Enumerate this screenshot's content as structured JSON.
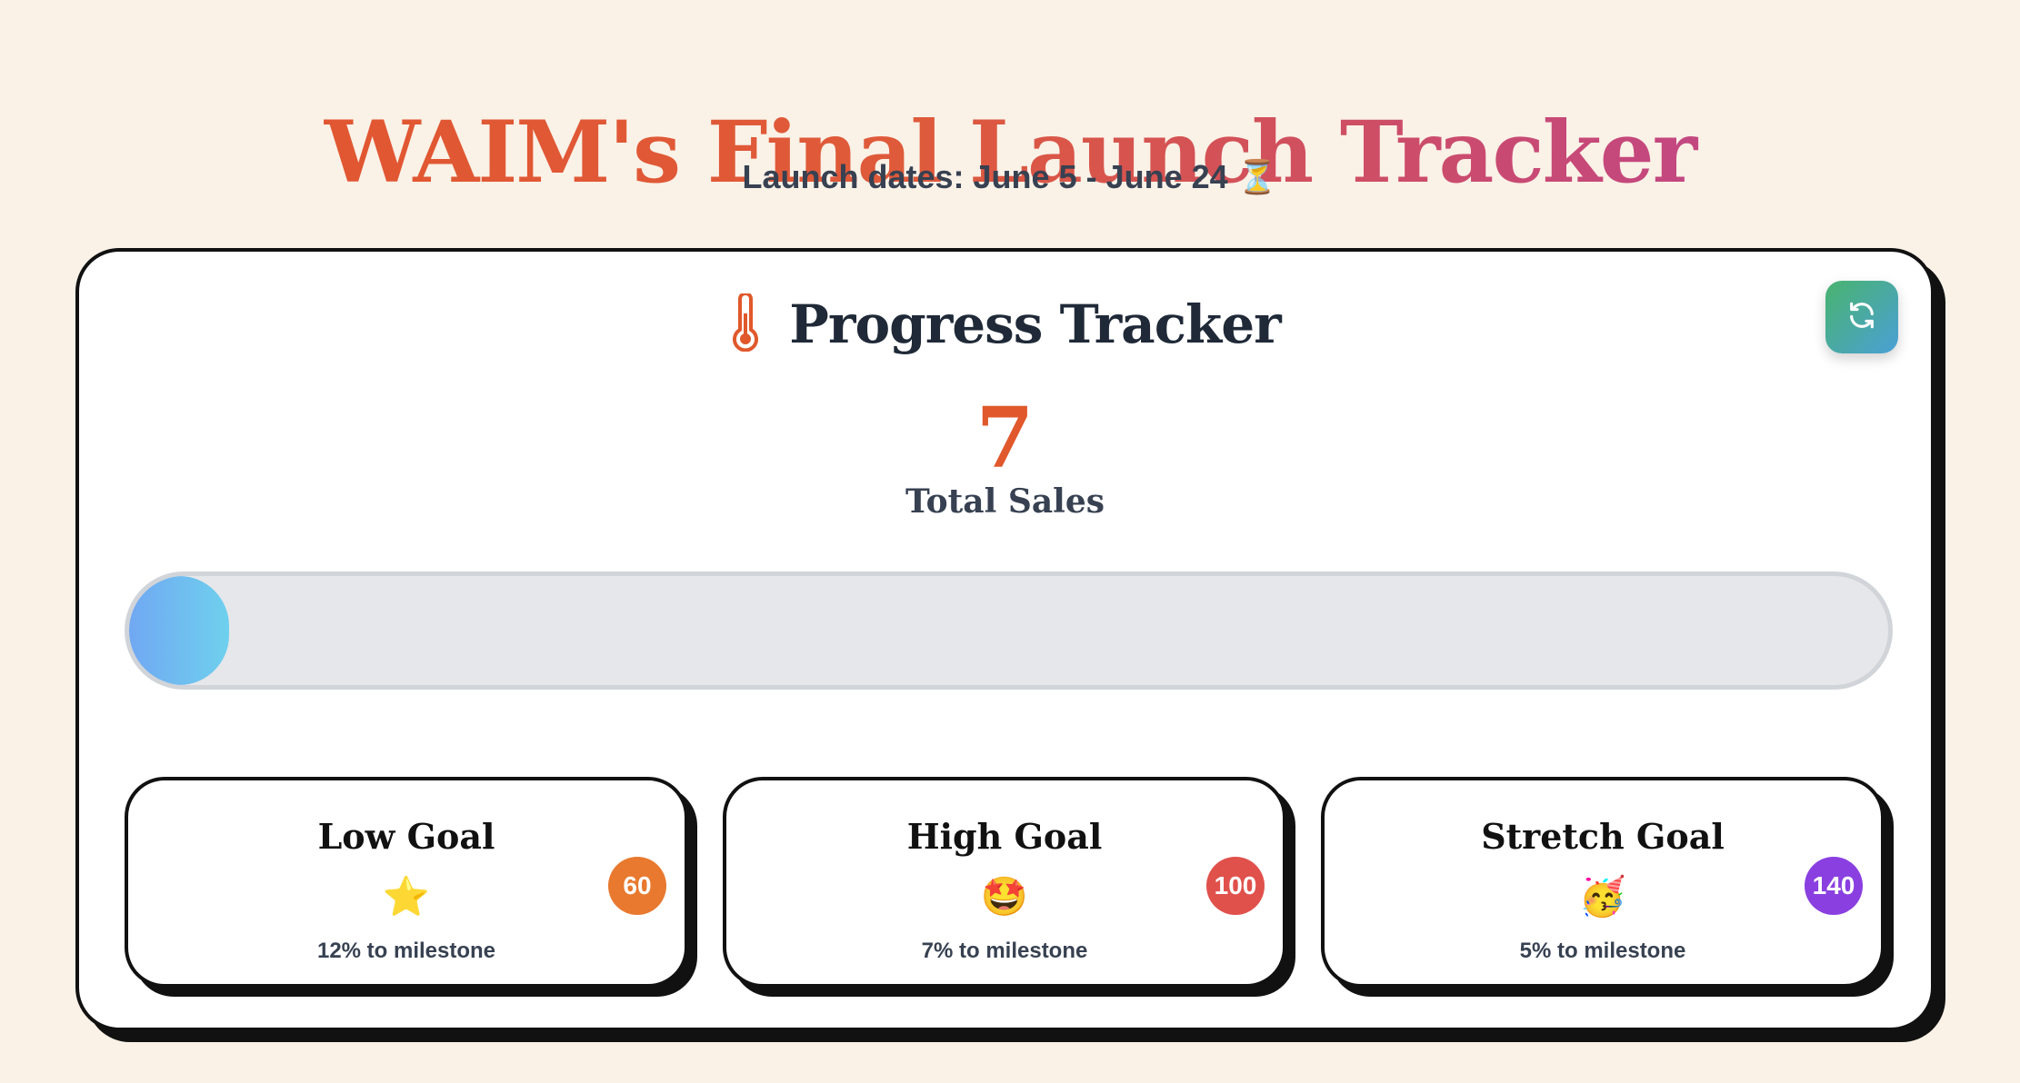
{
  "header": {
    "title": "WAIM's Final Launch Tracker",
    "subtitle": "Launch dates: June 5 - June 24 ⏳"
  },
  "tracker": {
    "heading": "Progress Tracker",
    "heading_icon": "thermometer-icon",
    "refresh_icon": "refresh-icon",
    "total_sales": "7",
    "total_sales_label": "Total Sales",
    "progress_fraction": 0.05
  },
  "goals": [
    {
      "title": "Low Goal",
      "emoji": "⭐",
      "emoji_name": "star",
      "target": "60",
      "progress_text": "12% to milestone",
      "color": "#e8792f"
    },
    {
      "title": "High Goal",
      "emoji": "🤩",
      "emoji_name": "star-struck",
      "target": "100",
      "progress_text": "7% to milestone",
      "color": "#e0514c"
    },
    {
      "title": "Stretch Goal",
      "emoji": "🥳",
      "emoji_name": "partying-face",
      "target": "140",
      "progress_text": "5% to milestone",
      "color": "#8a3fe0"
    }
  ],
  "colors": {
    "background": "#faf1e7",
    "accent": "#e0582b",
    "progress_start": "#70a8f2",
    "progress_end": "#6fd0ee"
  }
}
